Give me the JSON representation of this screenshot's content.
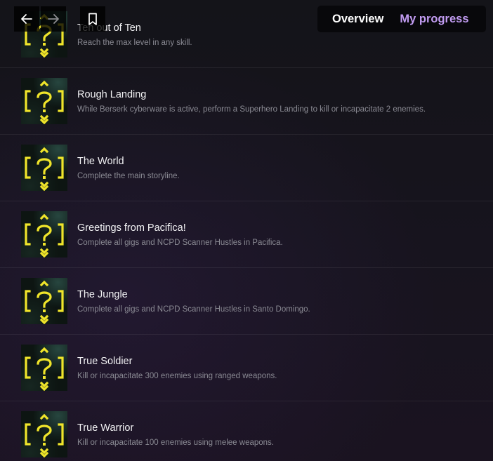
{
  "toolbar": {
    "back_icon": "arrow-left-icon",
    "forward_icon": "arrow-right-icon",
    "bookmark_icon": "bookmark-icon"
  },
  "tabs": {
    "overview": "Overview",
    "my_progress": "My progress"
  },
  "colors": {
    "accent": "#c29cf2",
    "icon_yellow": "#f0e52a",
    "title": "#f1f1f3",
    "description": "#8a8a93"
  },
  "achievements": [
    {
      "title": "Ten out of Ten",
      "description": "Reach the max level in any skill.",
      "icon": "locked-achievement-question-icon"
    },
    {
      "title": "Rough Landing",
      "description": "While Berserk cyberware is active, perform a Superhero Landing to kill or incapacitate 2 enemies.",
      "icon": "locked-achievement-question-icon"
    },
    {
      "title": "The World",
      "description": "Complete the main storyline.",
      "icon": "locked-achievement-question-icon"
    },
    {
      "title": "Greetings from Pacifica!",
      "description": "Complete all gigs and NCPD Scanner Hustles in Pacifica.",
      "icon": "locked-achievement-question-icon"
    },
    {
      "title": "The Jungle",
      "description": "Complete all gigs and NCPD Scanner Hustles in Santo Domingo.",
      "icon": "locked-achievement-question-icon"
    },
    {
      "title": "True Soldier",
      "description": "Kill or incapacitate 300 enemies using ranged weapons.",
      "icon": "locked-achievement-question-icon"
    },
    {
      "title": "True Warrior",
      "description": "Kill or incapacitate 100 enemies using melee weapons.",
      "icon": "locked-achievement-question-icon"
    }
  ]
}
